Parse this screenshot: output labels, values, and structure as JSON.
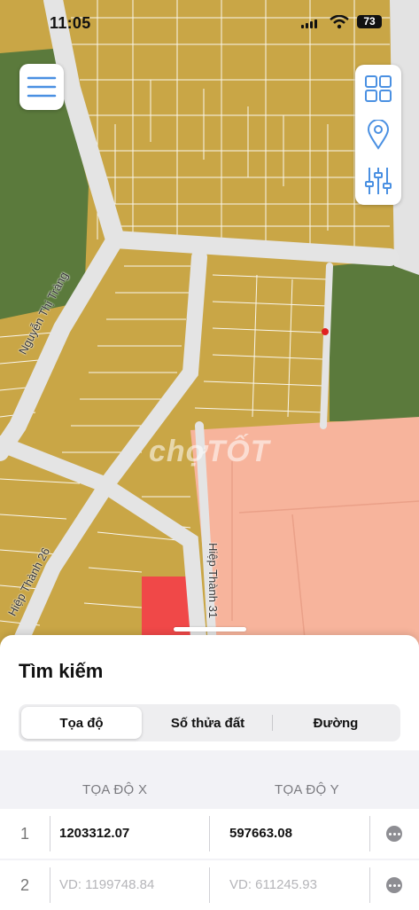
{
  "status_bar": {
    "time": "11:05",
    "battery": "73"
  },
  "map": {
    "watermark": "chợTỐT",
    "road_labels": [
      "Nguyễn Thị Tràng",
      "Hiệp Thành 26",
      "Hiệp Thành 31"
    ],
    "colors": {
      "residential": "#c9a646",
      "green": "#5b7a3c",
      "pink": "#f7b49c",
      "red": "#f04848",
      "road": "#e6e6e6"
    }
  },
  "toolbar": {
    "menu_icon": "hamburger-icon",
    "tools": [
      "grid-icon",
      "location-pin-icon",
      "sliders-icon"
    ],
    "accent": "#4a90e2"
  },
  "search": {
    "title": "Tìm kiếm",
    "tabs": [
      {
        "label": "Tọa độ",
        "active": true
      },
      {
        "label": "Số thửa đất",
        "active": false
      },
      {
        "label": "Đường",
        "active": false
      }
    ],
    "columns": {
      "x": "TỌA ĐỘ X",
      "y": "TỌA ĐỘ Y"
    },
    "rows": [
      {
        "num": "1",
        "x": "1203312.07",
        "y": "597663.08",
        "x_is_placeholder": false
      },
      {
        "num": "2",
        "x": "VD: 1199748.84",
        "y": "VD: 611245.93",
        "x_is_placeholder": true
      }
    ]
  }
}
